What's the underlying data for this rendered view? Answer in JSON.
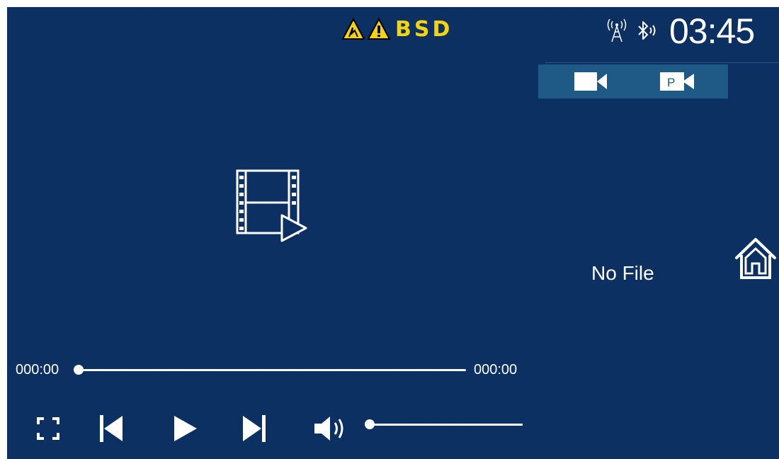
{
  "status_bar": {
    "bsd_label": "BSD",
    "clock": "03:45",
    "icons": [
      "warning-triangle-icon",
      "warning-triangle-icon",
      "antenna-signal-icon",
      "bluetooth-icon"
    ],
    "warning_color": "#f3d40f"
  },
  "camera_tabs": [
    {
      "name": "record-camera",
      "icon": "video-camera-icon"
    },
    {
      "name": "parking-camera",
      "icon": "parking-camera-icon",
      "badge": "P"
    }
  ],
  "main": {
    "empty_message": "No File",
    "placeholder_icon": "film-play-icon"
  },
  "playback": {
    "current_time": "000:00",
    "total_time": "000:00",
    "progress": 0,
    "volume": 0
  },
  "controls": [
    "fullscreen-icon",
    "previous-icon",
    "play-icon",
    "next-icon",
    "volume-icon"
  ],
  "colors": {
    "background": "#0b3061",
    "tab_bar": "#1f5a86",
    "foreground": "#ffffff"
  }
}
